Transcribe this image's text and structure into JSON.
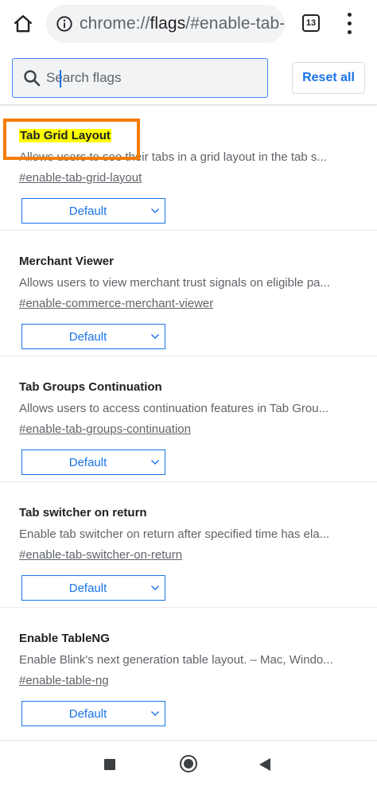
{
  "browser": {
    "url_prefix": "chrome://",
    "url_strong": "flags",
    "url_suffix": "/#enable-tab-gr",
    "tab_count": "13"
  },
  "search": {
    "placeholder": "Search flags",
    "value": ""
  },
  "reset_label": "Reset all",
  "flags": [
    {
      "title": "Tab Grid Layout",
      "description": "Allows users to see their tabs in a grid layout in the tab s...",
      "link": "#enable-tab-grid-layout",
      "selected": "Default"
    },
    {
      "title": "Merchant Viewer",
      "description": "Allows users to view merchant trust signals on eligible pa...",
      "link": "#enable-commerce-merchant-viewer",
      "selected": "Default"
    },
    {
      "title": "Tab Groups Continuation",
      "description": "Allows users to access continuation features in Tab Grou...",
      "link": "#enable-tab-groups-continuation",
      "selected": "Default"
    },
    {
      "title": "Tab switcher on return",
      "description": "Enable tab switcher on return after specified time has ela...",
      "link": "#enable-tab-switcher-on-return",
      "selected": "Default"
    },
    {
      "title": "Enable TableNG",
      "description": "Enable Blink's next generation table layout. – Mac, Windo...",
      "link": "#enable-table-ng",
      "selected": "Default"
    }
  ],
  "colors": {
    "accent": "#1a73e8",
    "highlight": "#ffff00",
    "annotation": "#f57c00"
  },
  "icons": {
    "home": "home-icon",
    "info": "info-icon",
    "tabs": "tab-switcher-icon",
    "menu": "more-vert-icon",
    "search": "search-icon",
    "chevron": "chevron-down-icon",
    "nav_recents": "recents-icon",
    "nav_home": "nav-home-icon",
    "nav_back": "back-icon"
  }
}
